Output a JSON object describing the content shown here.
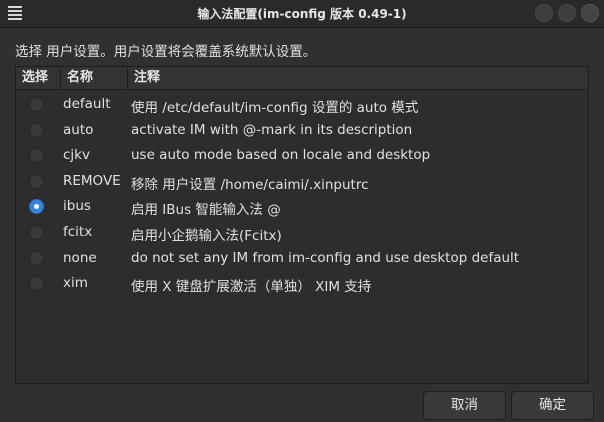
{
  "window": {
    "title": "输入法配置(im-config 版本 0.49-1)"
  },
  "description": "选择 用户设置。用户设置将会覆盖系统默认设置。",
  "list": {
    "headers": [
      "选择",
      "名称",
      "注释"
    ],
    "rows": [
      {
        "name": "default",
        "desc": "使用 /etc/default/im-config 设置的 auto 模式",
        "checked": false
      },
      {
        "name": "auto",
        "desc": "activate IM with @-mark in its description",
        "checked": false
      },
      {
        "name": "cjkv",
        "desc": "use auto mode based on locale and desktop",
        "checked": false
      },
      {
        "name": "REMOVE",
        "desc": "移除 用户设置 /home/caimi/.xinputrc",
        "checked": false
      },
      {
        "name": "ibus",
        "desc": "启用 IBus 智能输入法 @",
        "checked": true
      },
      {
        "name": "fcitx",
        "desc": "启用小企鹅输入法(Fcitx)",
        "checked": false
      },
      {
        "name": "none",
        "desc": "do not set any IM from im-config and use desktop default",
        "checked": false
      },
      {
        "name": "xim",
        "desc": "使用 X 键盘扩展激活（单独） XIM 支持",
        "checked": false
      }
    ]
  },
  "buttons": {
    "cancel": "取消",
    "ok": "确定"
  },
  "colors": {
    "accent": "#3584e4",
    "background": "#303030"
  },
  "icons": {
    "menu": "hamburger-menu-icon"
  }
}
